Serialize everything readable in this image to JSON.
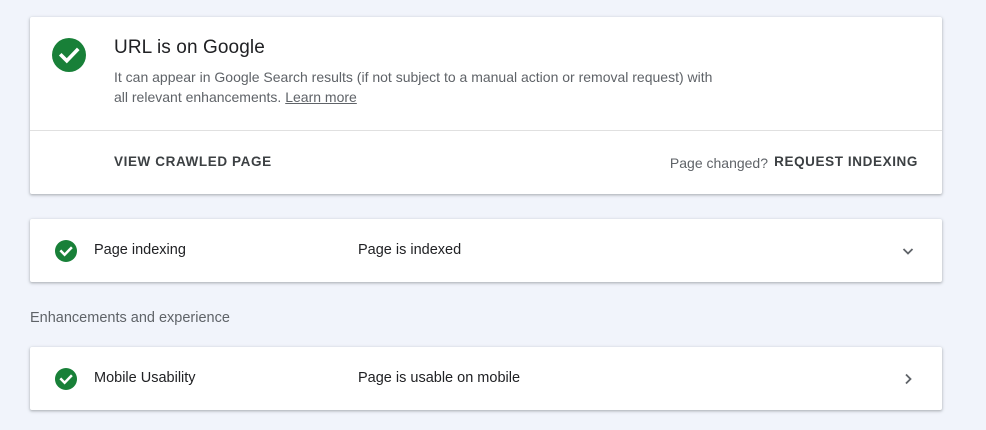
{
  "colors": {
    "success": "#188038",
    "background": "#f1f4fb",
    "card": "#ffffff"
  },
  "status": {
    "icon": "check-circle-icon",
    "title": "URL is on Google",
    "description": "It can appear in Google Search results (if not subject to a manual action or removal request) with all relevant enhancements. ",
    "learn_more": "Learn more",
    "view_crawled_label": "VIEW CRAWLED PAGE",
    "page_changed_label": "Page changed?",
    "request_indexing_label": "REQUEST INDEXING"
  },
  "indexing": {
    "icon": "check-circle-icon",
    "label": "Page indexing",
    "value": "Page is indexed",
    "chevron": "chevron-down-icon"
  },
  "enhancements": {
    "heading": "Enhancements and experience",
    "items": [
      {
        "icon": "check-circle-icon",
        "label": "Mobile Usability",
        "value": "Page is usable on mobile",
        "chevron": "chevron-right-icon"
      }
    ]
  }
}
